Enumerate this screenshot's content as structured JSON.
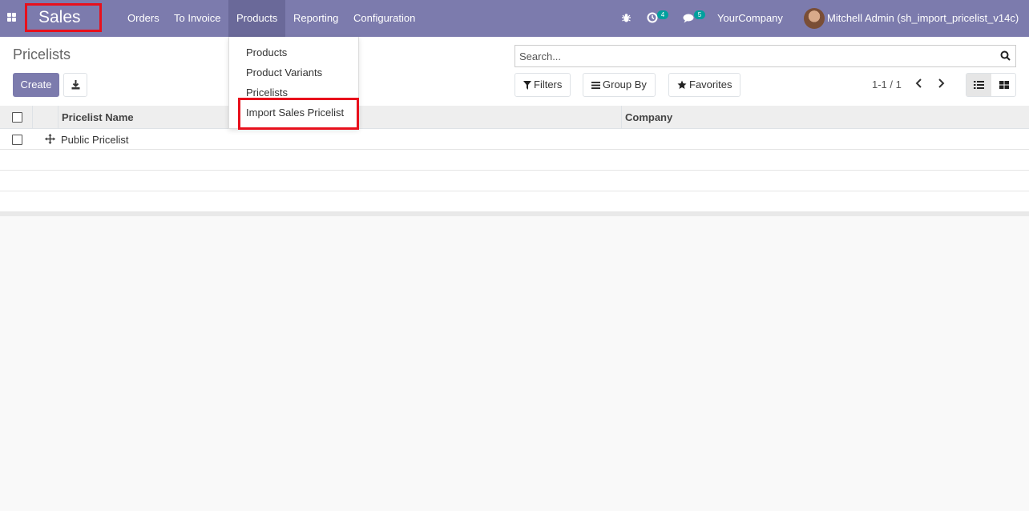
{
  "navbar": {
    "brand": "Sales",
    "menu": [
      "Orders",
      "To Invoice",
      "Products",
      "Reporting",
      "Configuration"
    ],
    "active_menu": "Products",
    "activity_count": "4",
    "message_count": "5",
    "company": "YourCompany",
    "user": "Mitchell Admin (sh_import_pricelist_v14c)",
    "accent_color": "#7c7bad"
  },
  "dropdown": {
    "items": [
      "Products",
      "Product Variants",
      "Pricelists",
      "Import Sales Pricelist"
    ],
    "highlighted_item": "Import Sales Pricelist"
  },
  "control_panel": {
    "title": "Pricelists",
    "create_label": "Create",
    "search_placeholder": "Search...",
    "filters_label": "Filters",
    "group_by_label": "Group By",
    "favorites_label": "Favorites",
    "pager": "1-1 / 1"
  },
  "table": {
    "columns": [
      "Pricelist Name",
      "Company"
    ],
    "rows": [
      {
        "name": "Public Pricelist",
        "company": ""
      }
    ]
  }
}
